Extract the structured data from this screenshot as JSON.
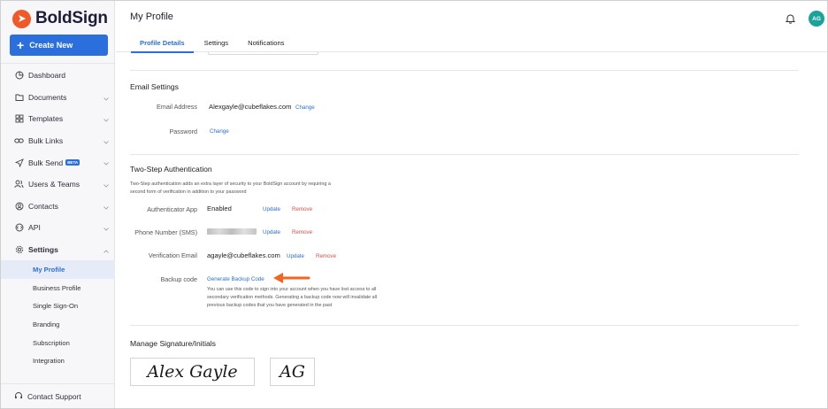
{
  "app": {
    "name": "BoldSign",
    "brand_color": "#f05a28",
    "accent": "#2a6fdb"
  },
  "sidebar": {
    "create_label": "Create New",
    "items": [
      {
        "label": "Dashboard",
        "icon": "dashboard-icon",
        "chevron": false
      },
      {
        "label": "Documents",
        "icon": "folder-icon",
        "chevron": true
      },
      {
        "label": "Templates",
        "icon": "templates-icon",
        "chevron": true
      },
      {
        "label": "Bulk Links",
        "icon": "link-icon",
        "chevron": true
      },
      {
        "label": "Bulk Send",
        "icon": "send-icon",
        "chevron": true,
        "badge": "BETA"
      },
      {
        "label": "Users & Teams",
        "icon": "users-icon",
        "chevron": true
      },
      {
        "label": "Contacts",
        "icon": "contacts-icon",
        "chevron": true
      },
      {
        "label": "API",
        "icon": "api-icon",
        "chevron": true
      },
      {
        "label": "Settings",
        "icon": "gear-icon",
        "chevron": true,
        "expanded": true
      }
    ],
    "settings_sub": [
      "My Profile",
      "Business Profile",
      "Single Sign-On",
      "Branding",
      "Subscription",
      "Integration"
    ],
    "active_sub": "My Profile",
    "support_label": "Contact Support"
  },
  "header": {
    "title": "My Profile",
    "tabs": [
      "Profile Details",
      "Settings",
      "Notifications"
    ],
    "active_tab": "Profile Details",
    "avatar_initials": "AG"
  },
  "email_settings": {
    "title": "Email Settings",
    "email_label": "Email Address",
    "email_value": "Alexgayle@cubeflakes.com",
    "email_change": "Change",
    "password_label": "Password",
    "password_change": "Change"
  },
  "two_step": {
    "title": "Two-Step Authentication",
    "description_1": "Two-Step authentication adds an extra layer of security to your BoldSign account by requiring a",
    "description_2": "second form of verification in addition to your password",
    "authenticator_label": "Authenticator App",
    "authenticator_value": "Enabled",
    "phone_label": "Phone Number (SMS)",
    "verification_label": "Verification Email",
    "verification_value": "agayle@cubeflakes.com",
    "update_label": "Update",
    "remove_label": "Remove",
    "backup_label": "Backup code",
    "backup_link": "Generate Backup Code",
    "backup_desc_1": "You can use this code to sign into your account when you have lost access to all",
    "backup_desc_2": "secondary verification methods. Generating a backup code now will invalidate all",
    "backup_desc_3": "previous backup codes that you have generated in the past"
  },
  "signature": {
    "title": "Manage Signature/Initials",
    "signature_text": "Alex Gayle",
    "initials_text": "AG"
  }
}
